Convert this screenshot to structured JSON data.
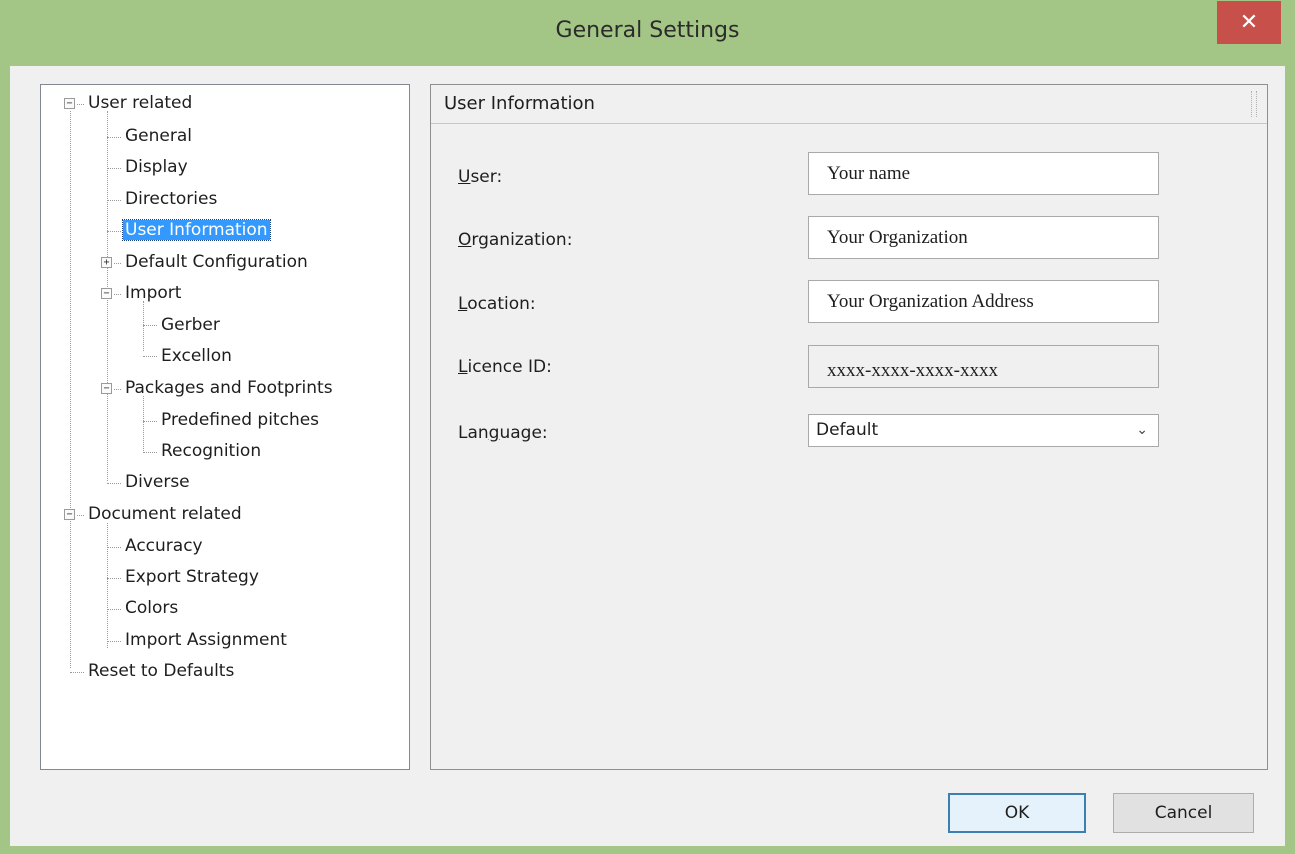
{
  "window": {
    "title": "General Settings",
    "close_glyph": "✕"
  },
  "tree": {
    "nodes": [
      {
        "label": "User related",
        "expander": "−"
      },
      {
        "label": "General"
      },
      {
        "label": "Display"
      },
      {
        "label": "Directories"
      },
      {
        "label": "User Information",
        "selected": true
      },
      {
        "label": "Default Configuration",
        "expander": "+"
      },
      {
        "label": "Import",
        "expander": "−"
      },
      {
        "label": "Gerber"
      },
      {
        "label": "Excellon"
      },
      {
        "label": "Packages and Footprints",
        "expander": "−"
      },
      {
        "label": "Predefined pitches"
      },
      {
        "label": "Recognition"
      },
      {
        "label": "Diverse"
      },
      {
        "label": "Document related",
        "expander": "−"
      },
      {
        "label": "Accuracy"
      },
      {
        "label": "Export Strategy"
      },
      {
        "label": "Colors"
      },
      {
        "label": "Import Assignment"
      },
      {
        "label": "Reset to Defaults"
      }
    ]
  },
  "panel": {
    "header": "User Information",
    "fields": {
      "user": {
        "label_first": "U",
        "label_rest": "ser:",
        "value": "Your name"
      },
      "organization": {
        "label_first": "O",
        "label_rest": "rganization:",
        "value": "Your Organization"
      },
      "location": {
        "label_first": "L",
        "label_rest": "ocation:",
        "value": "Your Organization Address"
      },
      "licence": {
        "label_first": "L",
        "label_rest": "icence ID:",
        "value": "xxxx-xxxx-xxxx-xxxx"
      },
      "language": {
        "label_pre": "Lan",
        "label_u": "g",
        "label_post": "uage:",
        "value": "Default"
      }
    }
  },
  "buttons": {
    "ok": "OK",
    "cancel": "Cancel"
  },
  "icons": {
    "close": "close-icon",
    "dropdown": "chevron-down-icon",
    "expand": "plus-icon",
    "collapse": "minus-icon"
  }
}
